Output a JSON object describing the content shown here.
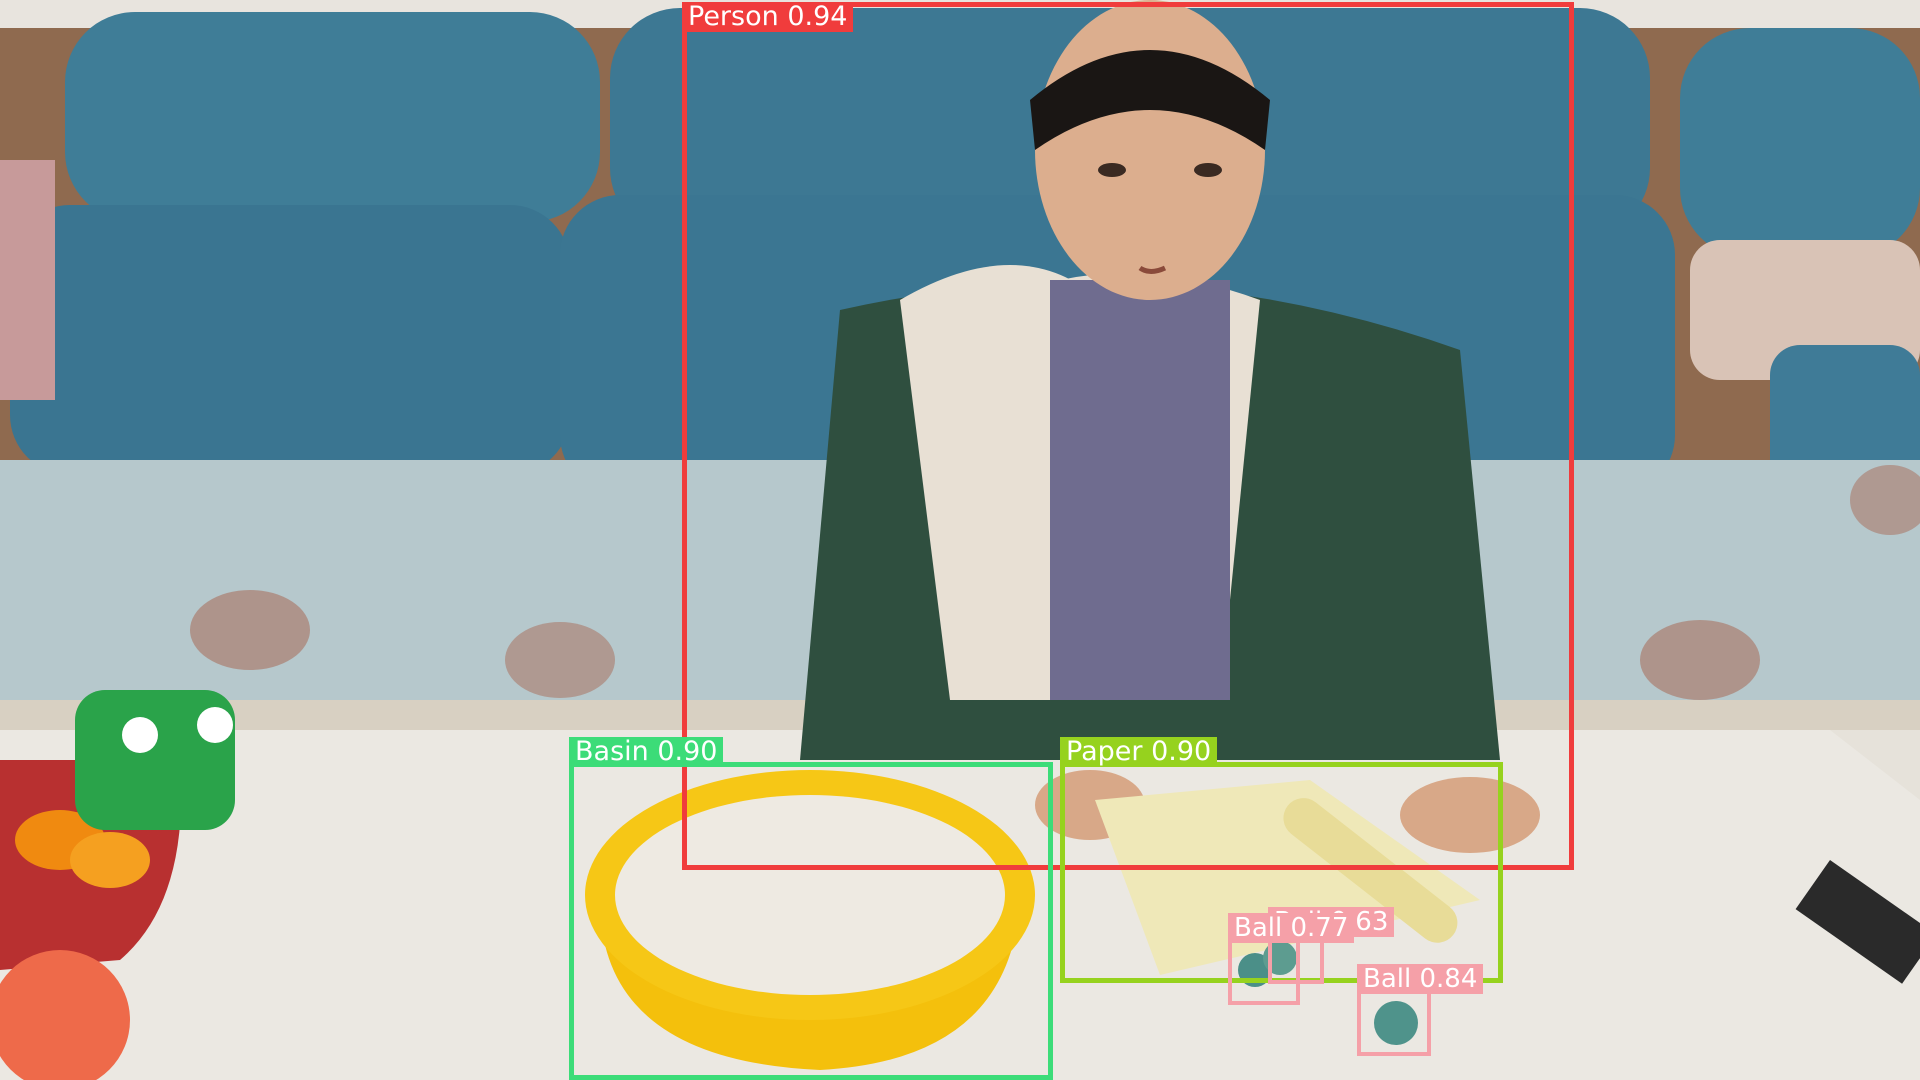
{
  "image": {
    "scene": "child seated on a blue sofa behind a white table with a yellow basin of flour, rolled paper and glass marbles"
  },
  "detections": [
    {
      "label": "Person",
      "score": "0.94",
      "color": "#f03c3c"
    },
    {
      "label": "Basin",
      "score": "0.90",
      "color": "#3cdc78"
    },
    {
      "label": "Paper",
      "score": "0.90",
      "color": "#96d21e"
    },
    {
      "label": "Ball",
      "score": "0.77",
      "color": "#f5a0a8"
    },
    {
      "label": "Ball",
      "score": "0.63",
      "color": "#f5a0a8"
    },
    {
      "label": "Ball",
      "score": "0.84",
      "color": "#f5a0a8"
    }
  ]
}
